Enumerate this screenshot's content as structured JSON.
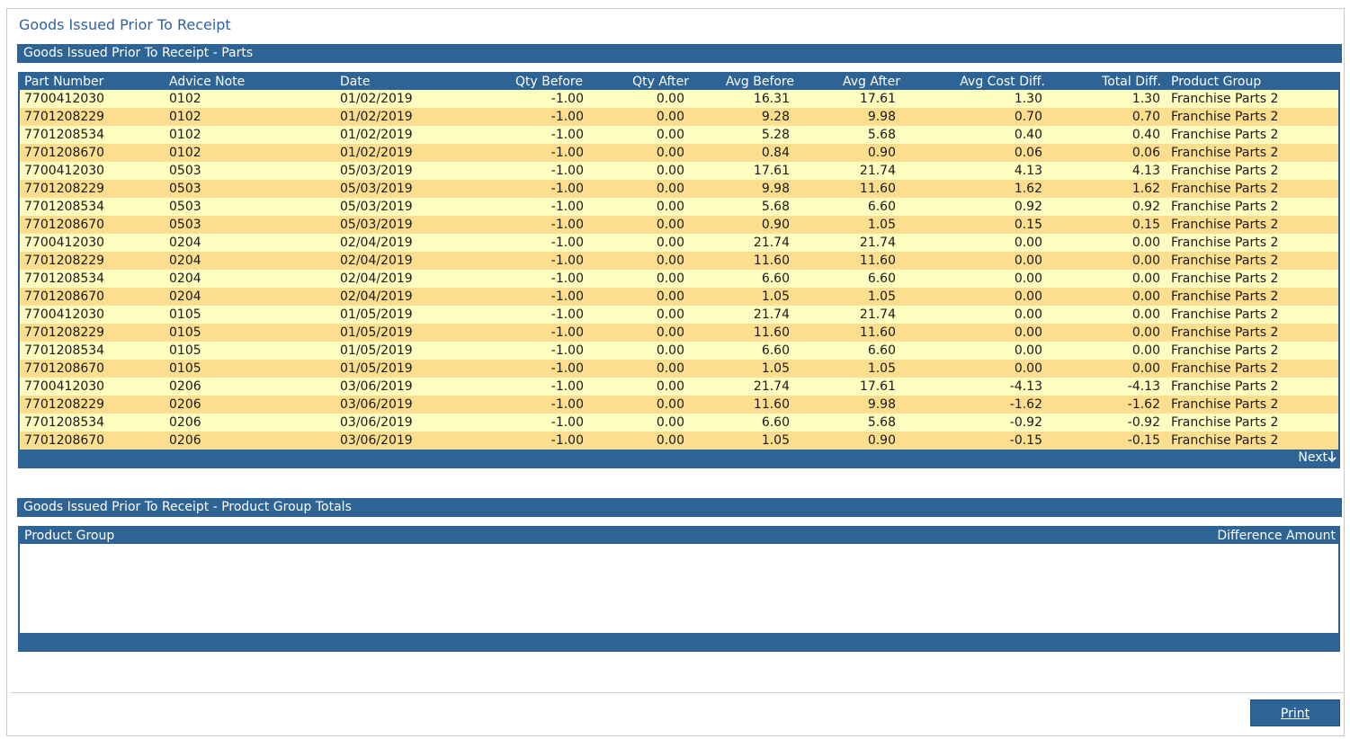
{
  "page": {
    "title": "Goods Issued Prior To Receipt"
  },
  "parts": {
    "header": "Goods Issued Prior To Receipt - Parts",
    "columns": [
      "Part Number",
      "Advice Note",
      "Date",
      "Qty Before",
      "Qty After",
      "Avg Before",
      "Avg After",
      "Avg Cost Diff.",
      "Total Diff.",
      "Product Group"
    ],
    "rows": [
      [
        "7700412030",
        "0102",
        "01/02/2019",
        "-1.00",
        "0.00",
        "16.31",
        "17.61",
        "1.30",
        "1.30",
        "Franchise Parts 2"
      ],
      [
        "7701208229",
        "0102",
        "01/02/2019",
        "-1.00",
        "0.00",
        "9.28",
        "9.98",
        "0.70",
        "0.70",
        "Franchise Parts 2"
      ],
      [
        "7701208534",
        "0102",
        "01/02/2019",
        "-1.00",
        "0.00",
        "5.28",
        "5.68",
        "0.40",
        "0.40",
        "Franchise Parts 2"
      ],
      [
        "7701208670",
        "0102",
        "01/02/2019",
        "-1.00",
        "0.00",
        "0.84",
        "0.90",
        "0.06",
        "0.06",
        "Franchise Parts 2"
      ],
      [
        "7700412030",
        "0503",
        "05/03/2019",
        "-1.00",
        "0.00",
        "17.61",
        "21.74",
        "4.13",
        "4.13",
        "Franchise Parts 2"
      ],
      [
        "7701208229",
        "0503",
        "05/03/2019",
        "-1.00",
        "0.00",
        "9.98",
        "11.60",
        "1.62",
        "1.62",
        "Franchise Parts 2"
      ],
      [
        "7701208534",
        "0503",
        "05/03/2019",
        "-1.00",
        "0.00",
        "5.68",
        "6.60",
        "0.92",
        "0.92",
        "Franchise Parts 2"
      ],
      [
        "7701208670",
        "0503",
        "05/03/2019",
        "-1.00",
        "0.00",
        "0.90",
        "1.05",
        "0.15",
        "0.15",
        "Franchise Parts 2"
      ],
      [
        "7700412030",
        "0204",
        "02/04/2019",
        "-1.00",
        "0.00",
        "21.74",
        "21.74",
        "0.00",
        "0.00",
        "Franchise Parts 2"
      ],
      [
        "7701208229",
        "0204",
        "02/04/2019",
        "-1.00",
        "0.00",
        "11.60",
        "11.60",
        "0.00",
        "0.00",
        "Franchise Parts 2"
      ],
      [
        "7701208534",
        "0204",
        "02/04/2019",
        "-1.00",
        "0.00",
        "6.60",
        "6.60",
        "0.00",
        "0.00",
        "Franchise Parts 2"
      ],
      [
        "7701208670",
        "0204",
        "02/04/2019",
        "-1.00",
        "0.00",
        "1.05",
        "1.05",
        "0.00",
        "0.00",
        "Franchise Parts 2"
      ],
      [
        "7700412030",
        "0105",
        "01/05/2019",
        "-1.00",
        "0.00",
        "21.74",
        "21.74",
        "0.00",
        "0.00",
        "Franchise Parts 2"
      ],
      [
        "7701208229",
        "0105",
        "01/05/2019",
        "-1.00",
        "0.00",
        "11.60",
        "11.60",
        "0.00",
        "0.00",
        "Franchise Parts 2"
      ],
      [
        "7701208534",
        "0105",
        "01/05/2019",
        "-1.00",
        "0.00",
        "6.60",
        "6.60",
        "0.00",
        "0.00",
        "Franchise Parts 2"
      ],
      [
        "7701208670",
        "0105",
        "01/05/2019",
        "-1.00",
        "0.00",
        "1.05",
        "1.05",
        "0.00",
        "0.00",
        "Franchise Parts 2"
      ],
      [
        "7700412030",
        "0206",
        "03/06/2019",
        "-1.00",
        "0.00",
        "21.74",
        "17.61",
        "-4.13",
        "-4.13",
        "Franchise Parts 2"
      ],
      [
        "7701208229",
        "0206",
        "03/06/2019",
        "-1.00",
        "0.00",
        "11.60",
        "9.98",
        "-1.62",
        "-1.62",
        "Franchise Parts 2"
      ],
      [
        "7701208534",
        "0206",
        "03/06/2019",
        "-1.00",
        "0.00",
        "6.60",
        "5.68",
        "-0.92",
        "-0.92",
        "Franchise Parts 2"
      ],
      [
        "7701208670",
        "0206",
        "03/06/2019",
        "-1.00",
        "0.00",
        "1.05",
        "0.90",
        "-0.15",
        "-0.15",
        "Franchise Parts 2"
      ]
    ],
    "next_label": "Next",
    "next_icon": "arrow-down-icon"
  },
  "totals": {
    "header": "Goods Issued Prior To Receipt - Product Group Totals",
    "col_product_group": "Product Group",
    "col_difference_amount": "Difference Amount"
  },
  "footer": {
    "print_label": "Print"
  },
  "colors": {
    "accent": "#2e6396",
    "row_odd": "#fefcbe",
    "row_even": "#fdde8f",
    "title": "#2f62a0"
  }
}
